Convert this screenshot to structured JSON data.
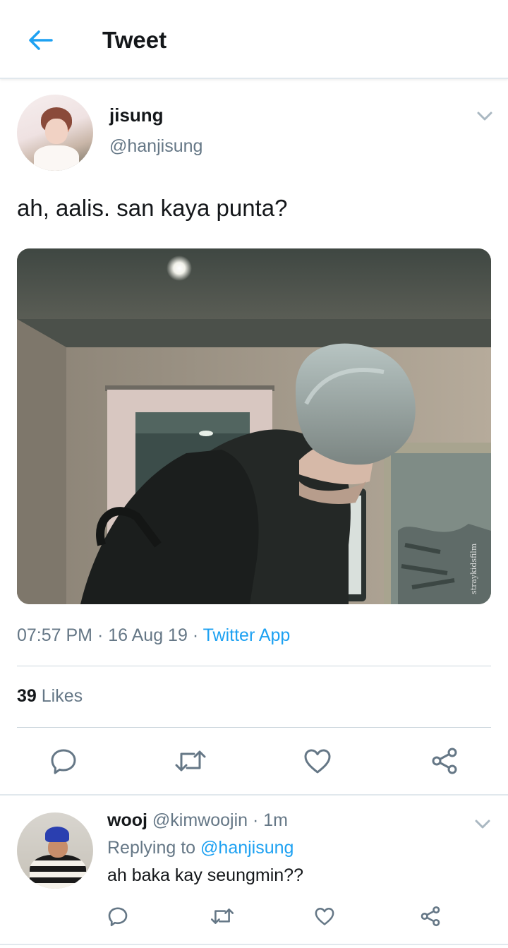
{
  "header": {
    "title": "Tweet",
    "back_icon": "arrow-left-icon",
    "accent": "#1da1f2"
  },
  "tweet": {
    "author_name": "jisung",
    "author_handle": "@hanjisung",
    "text": "ah, aalis. san kaya punta?",
    "time": "07:57 PM",
    "date": "16 Aug 19",
    "separator": "·",
    "source": "Twitter App",
    "media_watermark": "straykidsfilm",
    "likes_count": "39",
    "likes_label": "Likes",
    "actions": [
      "reply-icon",
      "retweet-icon",
      "like-icon",
      "share-icon"
    ]
  },
  "reply": {
    "author_name": "wooj",
    "author_handle": "@kimwoojin",
    "time": "· 1m",
    "replying_prefix": "Replying to",
    "replying_to": "@hanjisung",
    "text": "ah baka kay seungmin??",
    "actions": [
      "reply-icon",
      "retweet-icon",
      "like-icon",
      "share-icon"
    ]
  },
  "colors": {
    "text": "#14171a",
    "secondary": "#657786",
    "link": "#1da1f2",
    "divider": "#ccd6dd"
  }
}
